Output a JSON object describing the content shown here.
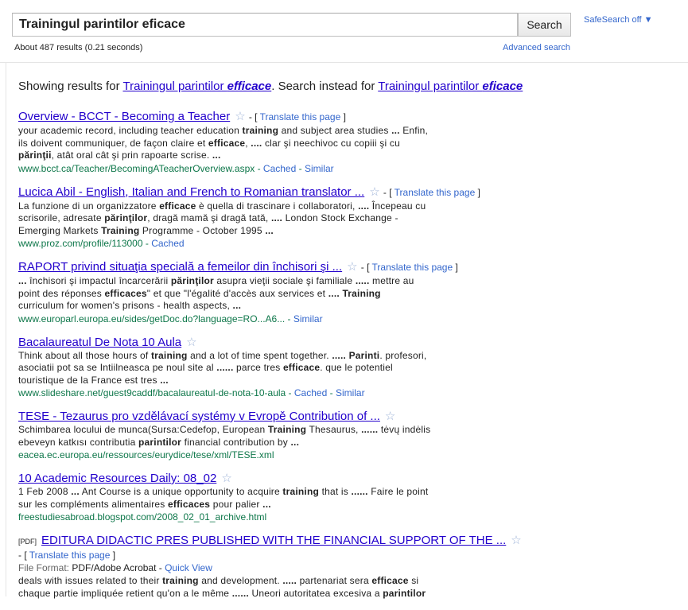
{
  "search": {
    "query": "Trainingul parintilor eficace",
    "button_label": "Search",
    "safesearch_label": "SafeSearch off ▼",
    "result_stats": "About 487 results (0.21 seconds)",
    "advanced_label": "Advanced search"
  },
  "spell": {
    "prefix": "Showing results for ",
    "corrected_plain": "Trainingul parintilor ",
    "corrected_bold": "efficace",
    "mid": ". Search instead for ",
    "original_plain": "Trainingul parintilor ",
    "original_bold": "eficace"
  },
  "common": {
    "translate_label": "Translate this page",
    "cached_label": "Cached",
    "similar_label": "Similar",
    "quick_view_label": "Quick View",
    "star_glyph": "☆"
  },
  "results": [
    {
      "title": "Overview - BCCT - Becoming a Teacher",
      "translate": true,
      "snippet_lines": [
        [
          {
            "t": "your academic record, including teacher education "
          },
          {
            "t": "training",
            "b": true
          },
          {
            "t": " and subject area studies "
          },
          {
            "t": "...",
            "b": true
          },
          {
            "t": " Enfin,"
          }
        ],
        [
          {
            "t": "ils doivent communiquer, de façon claire et "
          },
          {
            "t": "efficace",
            "b": true
          },
          {
            "t": ", "
          },
          {
            "t": "....",
            "b": true
          },
          {
            "t": " clar şi neechivoc cu copiii şi cu"
          }
        ],
        [
          {
            "t": "părinţii",
            "b": true
          },
          {
            "t": ", atât oral cât şi prin rapoarte scrise. "
          },
          {
            "t": "...",
            "b": true
          }
        ]
      ],
      "url": "www.bcct.ca/Teacher/BecomingATeacherOverview.aspx",
      "cached": true,
      "similar": true
    },
    {
      "title": "Lucica Abil - English, Italian and French to Romanian translator ...",
      "translate": true,
      "snippet_lines": [
        [
          {
            "t": "La funzione di un organizzatore "
          },
          {
            "t": "efficace",
            "b": true
          },
          {
            "t": " è quella di trascinare i collaboratori, "
          },
          {
            "t": "....",
            "b": true
          },
          {
            "t": " Începeau cu"
          }
        ],
        [
          {
            "t": "scrisorile, adresate "
          },
          {
            "t": "părinţilor",
            "b": true
          },
          {
            "t": ", dragă mamă şi dragă tată, "
          },
          {
            "t": "....",
            "b": true
          },
          {
            "t": " London Stock Exchange -"
          }
        ],
        [
          {
            "t": "Emerging Markets "
          },
          {
            "t": "Training",
            "b": true
          },
          {
            "t": " Programme - October 1995 "
          },
          {
            "t": "...",
            "b": true
          }
        ]
      ],
      "url": "www.proz.com/profile/113000",
      "cached": true,
      "similar": false
    },
    {
      "title": "RAPORT privind situaţia specială a femeilor din închisori şi ...",
      "translate": true,
      "snippet_lines": [
        [
          {
            "t": "...",
            "b": true
          },
          {
            "t": " închisori şi impactul încarcerării "
          },
          {
            "t": "părinţilor",
            "b": true
          },
          {
            "t": " asupra vieţii sociale şi familiale "
          },
          {
            "t": ".....",
            "b": true
          },
          {
            "t": " mettre au"
          }
        ],
        [
          {
            "t": "point des réponses "
          },
          {
            "t": "efficaces",
            "b": true
          },
          {
            "t": "\" et que \"l'égalité d'accès aux services et "
          },
          {
            "t": "....",
            "b": true
          },
          {
            "t": " "
          },
          {
            "t": "Training",
            "b": true
          }
        ],
        [
          {
            "t": "curriculum for women's prisons - health aspects, "
          },
          {
            "t": "...",
            "b": true
          }
        ]
      ],
      "url": "www.europarl.europa.eu/sides/getDoc.do?language=RO...A6...",
      "cached": false,
      "similar": true
    },
    {
      "title": "Bacalaureatul De Nota 10 Aula",
      "translate": false,
      "snippet_lines": [
        [
          {
            "t": "Think about all those hours of "
          },
          {
            "t": "training",
            "b": true
          },
          {
            "t": " and a lot of time spent together. "
          },
          {
            "t": ".....",
            "b": true
          },
          {
            "t": " "
          },
          {
            "t": "Parinti",
            "b": true
          },
          {
            "t": ". profesori,"
          }
        ],
        [
          {
            "t": "asociatii pot sa se Intiilneasca pe noul site al "
          },
          {
            "t": "......",
            "b": true
          },
          {
            "t": " parce tres "
          },
          {
            "t": "efficace",
            "b": true
          },
          {
            "t": ". que le potentiel"
          }
        ],
        [
          {
            "t": "touristique de la France est tres "
          },
          {
            "t": "...",
            "b": true
          }
        ]
      ],
      "url": "www.slideshare.net/guest9caddf/bacalaureatul-de-nota-10-aula",
      "cached": true,
      "similar": true
    },
    {
      "title": "TESE - Tezaurus pro vzdělávací systémy v Evropě Contribution of ...",
      "translate": false,
      "snippet_lines": [
        [
          {
            "t": "Schimbarea locului de munca(Sursa:Cedefop, European "
          },
          {
            "t": "Training",
            "b": true
          },
          {
            "t": " Thesaurus, "
          },
          {
            "t": "......",
            "b": true
          },
          {
            "t": " tėvų indėlis"
          }
        ],
        [
          {
            "t": "ebeveyn katkısı contributia "
          },
          {
            "t": "parintilor",
            "b": true
          },
          {
            "t": " financial contribution by "
          },
          {
            "t": "...",
            "b": true
          }
        ]
      ],
      "url": "eacea.ec.europa.eu/ressources/eurydice/tese/xml/TESE.xml",
      "cached": false,
      "similar": false
    },
    {
      "title": "10 Academic Resources Daily: 08_02",
      "translate": false,
      "snippet_lines": [
        [
          {
            "t": "1 Feb 2008 "
          },
          {
            "t": "...",
            "b": true
          },
          {
            "t": " Ant Course is a unique opportunity to acquire "
          },
          {
            "t": "training",
            "b": true
          },
          {
            "t": " that is "
          },
          {
            "t": "......",
            "b": true
          },
          {
            "t": " Faire le point"
          }
        ],
        [
          {
            "t": "sur les compléments alimentaires "
          },
          {
            "t": "efficaces",
            "b": true
          },
          {
            "t": " pour palier "
          },
          {
            "t": "...",
            "b": true
          }
        ]
      ],
      "url": "freestudiesabroad.blogspot.com/2008_02_01_archive.html",
      "cached": false,
      "similar": false
    },
    {
      "pdf_tag": "[PDF]",
      "title": "EDITURA DIDACTIC PRES PUBLISHED WITH THE FINANCIAL SUPPORT OF THE ...",
      "translate": true,
      "translate_newline": true,
      "file_format_label": "File Format:",
      "file_format": "PDF/Adobe Acrobat",
      "quick_view": true,
      "snippet_lines": [
        [
          {
            "t": "deals with issues related to their "
          },
          {
            "t": "training",
            "b": true
          },
          {
            "t": " and development. "
          },
          {
            "t": ".....",
            "b": true
          },
          {
            "t": " partenariat sera "
          },
          {
            "t": "efficace",
            "b": true
          },
          {
            "t": " si"
          }
        ],
        [
          {
            "t": "chaque partie impliquée retient qu'on a le même "
          },
          {
            "t": "......",
            "b": true
          },
          {
            "t": " Uneori autoritatea excesiva a "
          },
          {
            "t": "parintilor",
            "b": true
          }
        ]
      ],
      "url": "",
      "cached": false,
      "similar": false
    }
  ]
}
